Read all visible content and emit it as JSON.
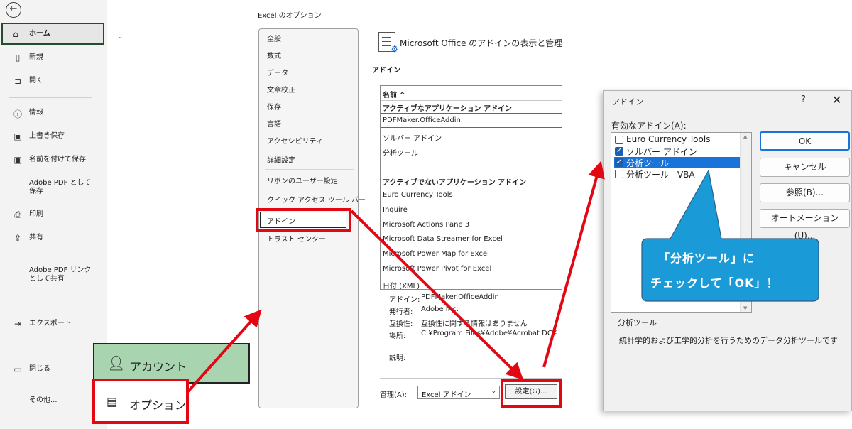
{
  "backstage": {
    "back_icon": "arrow-left-icon",
    "items": [
      {
        "label": "ホーム",
        "icon": "home-icon"
      },
      {
        "label": "新規",
        "icon": "new-document-icon"
      },
      {
        "label": "開く",
        "icon": "folder-open-icon"
      },
      {
        "label": "情報",
        "icon": "info-icon"
      },
      {
        "label": "上書き保存",
        "icon": "save-icon"
      },
      {
        "label": "名前を付けて保存",
        "icon": "save-as-icon"
      },
      {
        "label": "Adobe PDF として",
        "label2": "保存",
        "icon": ""
      },
      {
        "label": "印刷",
        "icon": "print-icon"
      },
      {
        "label": "共有",
        "icon": "share-icon"
      },
      {
        "label": "Adobe PDF リンク",
        "label2": "として共有",
        "icon": ""
      },
      {
        "label": "エクスポート",
        "icon": "export-icon"
      },
      {
        "label": "閉じる",
        "icon": "close-folder-icon"
      },
      {
        "label": "その他...",
        "icon": ""
      }
    ],
    "account_label": "アカウント",
    "options_label": "オプション"
  },
  "options": {
    "window_title": "Excel のオプション",
    "nav": [
      "全般",
      "数式",
      "データ",
      "文章校正",
      "保存",
      "言語",
      "アクセシビリティ",
      "詳細設定",
      "リボンのユーザー設定",
      "クイック アクセス ツール バー",
      "アドイン",
      "トラスト センター"
    ],
    "heading": "Microsoft Office のアドインの表示と管理を行います。",
    "section": "アドイン",
    "list_header": "名前 ^",
    "active_header": "アクティブなアプリケーション アドイン",
    "active_items": [
      "PDFMaker.OfficeAddin",
      "ソルバー アドイン",
      "分析ツール"
    ],
    "inactive_header": "アクティブでないアプリケーション アドイン",
    "inactive_items": [
      "Euro Currency Tools",
      "Inquire",
      "Microsoft Actions Pane 3",
      "Microsoft Data Streamer for Excel",
      "Microsoft Power Map for Excel",
      "Microsoft Power Pivot for Excel",
      "日付 (XML)"
    ],
    "details": [
      {
        "key": "アドイン:",
        "value": "PDFMaker.OfficeAddin"
      },
      {
        "key": "発行者:",
        "value": "Adobe Inc."
      },
      {
        "key": "互換性:",
        "value": "互換性に関する情報はありません"
      },
      {
        "key": "場所:",
        "value": "C:¥Program Files¥Adobe¥Acrobat DC¥"
      }
    ],
    "desc_label": "説明:",
    "manage_label": "管理(A):",
    "manage_value": "Excel アドイン",
    "go_button": "設定(G)..."
  },
  "dialog": {
    "title": "アドイン",
    "help": "?",
    "close": "✕",
    "available_label": "有効なアドイン(A):",
    "items": [
      {
        "label": "Euro Currency Tools",
        "checked": false
      },
      {
        "label": "ソルバー アドイン",
        "checked": true
      },
      {
        "label": "分析ツール",
        "checked": true
      },
      {
        "label": "分析ツール - VBA",
        "checked": false
      }
    ],
    "buttons": [
      "OK",
      "キャンセル",
      "参照(B)...",
      "オートメーション(U)..."
    ],
    "group_label": "分析ツール",
    "description": "統計学的および工学的分析を行うためのデータ分析ツールです"
  },
  "callout": {
    "line1": "「分析ツール」に",
    "line2": "チェックして「OK」！"
  },
  "colors": {
    "highlight_red": "#e30613",
    "callout_blue": "#1a9ad6",
    "selection_blue": "#1a73d9",
    "account_green": "#a8d4b0"
  }
}
